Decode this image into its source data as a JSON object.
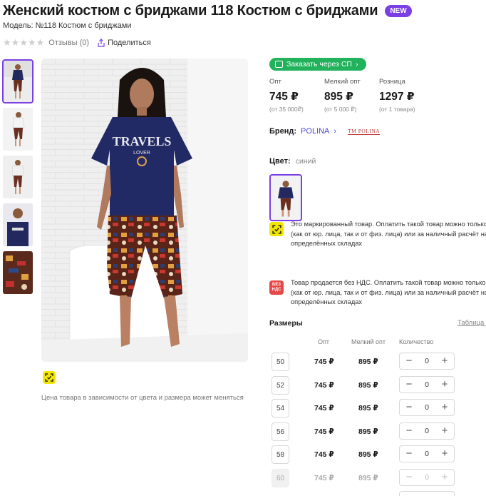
{
  "product": {
    "title": "Женский костюм с бриджами 118 Костюм с бриджами",
    "badge": "NEW",
    "model": "Модель: №118 Костюм с бриджами",
    "reviews": "Отзывы (0)",
    "share": "Поделиться",
    "stars": "★★★★★"
  },
  "gallery": {
    "thumbnails": [
      "thumb-1",
      "thumb-2",
      "thumb-3",
      "thumb-4",
      "thumb-5"
    ],
    "main_print_title": "TRAVELS",
    "main_print_sub": "LOVER",
    "price_note": "Цена товара в зависимости от цвета и размера может меняться"
  },
  "purchase": {
    "sp_button": "Заказать через СП",
    "prices": [
      {
        "label": "Опт",
        "value": "745 ₽",
        "sub": "(от 35 000₽)"
      },
      {
        "label": "Мелкий опт",
        "value": "895 ₽",
        "sub": "(от 5 000 ₽)"
      },
      {
        "label": "Розница",
        "value": "1297 ₽",
        "sub": "(от 1 товара)"
      }
    ],
    "brand_label": "Бренд:",
    "brand_name": "POLINA",
    "brand_logo_text": "TM POLINA",
    "color_label": "Цвет:",
    "color_value": "синий"
  },
  "notices": [
    {
      "lines": [
        "Это маркированный товар. Оплатить такой товар можно только",
        "(как от юр. лица, так и от физ. лица) или за наличный расчёт на",
        "определённых складах"
      ]
    },
    {
      "icon_text": "БЕЗ НДС",
      "lines": [
        "Товар продается без НДС. Оплатить такой товар можно только",
        "(как от юр. лица, так и от физ. лица) или за наличный расчёт на",
        "определённых складах"
      ]
    }
  ],
  "sizes": {
    "label": "Размеры",
    "table_link": "Таблица р",
    "columns": {
      "opt": "Опт",
      "small_opt": "Мелкий опт",
      "qty": "Количество"
    },
    "rows": [
      {
        "size": "50",
        "opt": "745 ₽",
        "small_opt": "895 ₽",
        "qty": "0"
      },
      {
        "size": "52",
        "opt": "745 ₽",
        "small_opt": "895 ₽",
        "qty": "0"
      },
      {
        "size": "54",
        "opt": "745 ₽",
        "small_opt": "895 ₽",
        "qty": "0"
      },
      {
        "size": "56",
        "opt": "745 ₽",
        "small_opt": "895 ₽",
        "qty": "0"
      },
      {
        "size": "58",
        "opt": "745 ₽",
        "small_opt": "895 ₽",
        "qty": "0"
      },
      {
        "size": "60",
        "opt": "745 ₽",
        "small_opt": "895 ₽",
        "qty": "0",
        "disabled": true
      }
    ],
    "minus": "−",
    "plus": "+"
  },
  "colors": {
    "accent": "#7b3fe4",
    "green": "#21b25b",
    "brand_link": "#4a46d8",
    "marker_yellow": "#f2e600",
    "no_vat_red": "#e64646"
  }
}
